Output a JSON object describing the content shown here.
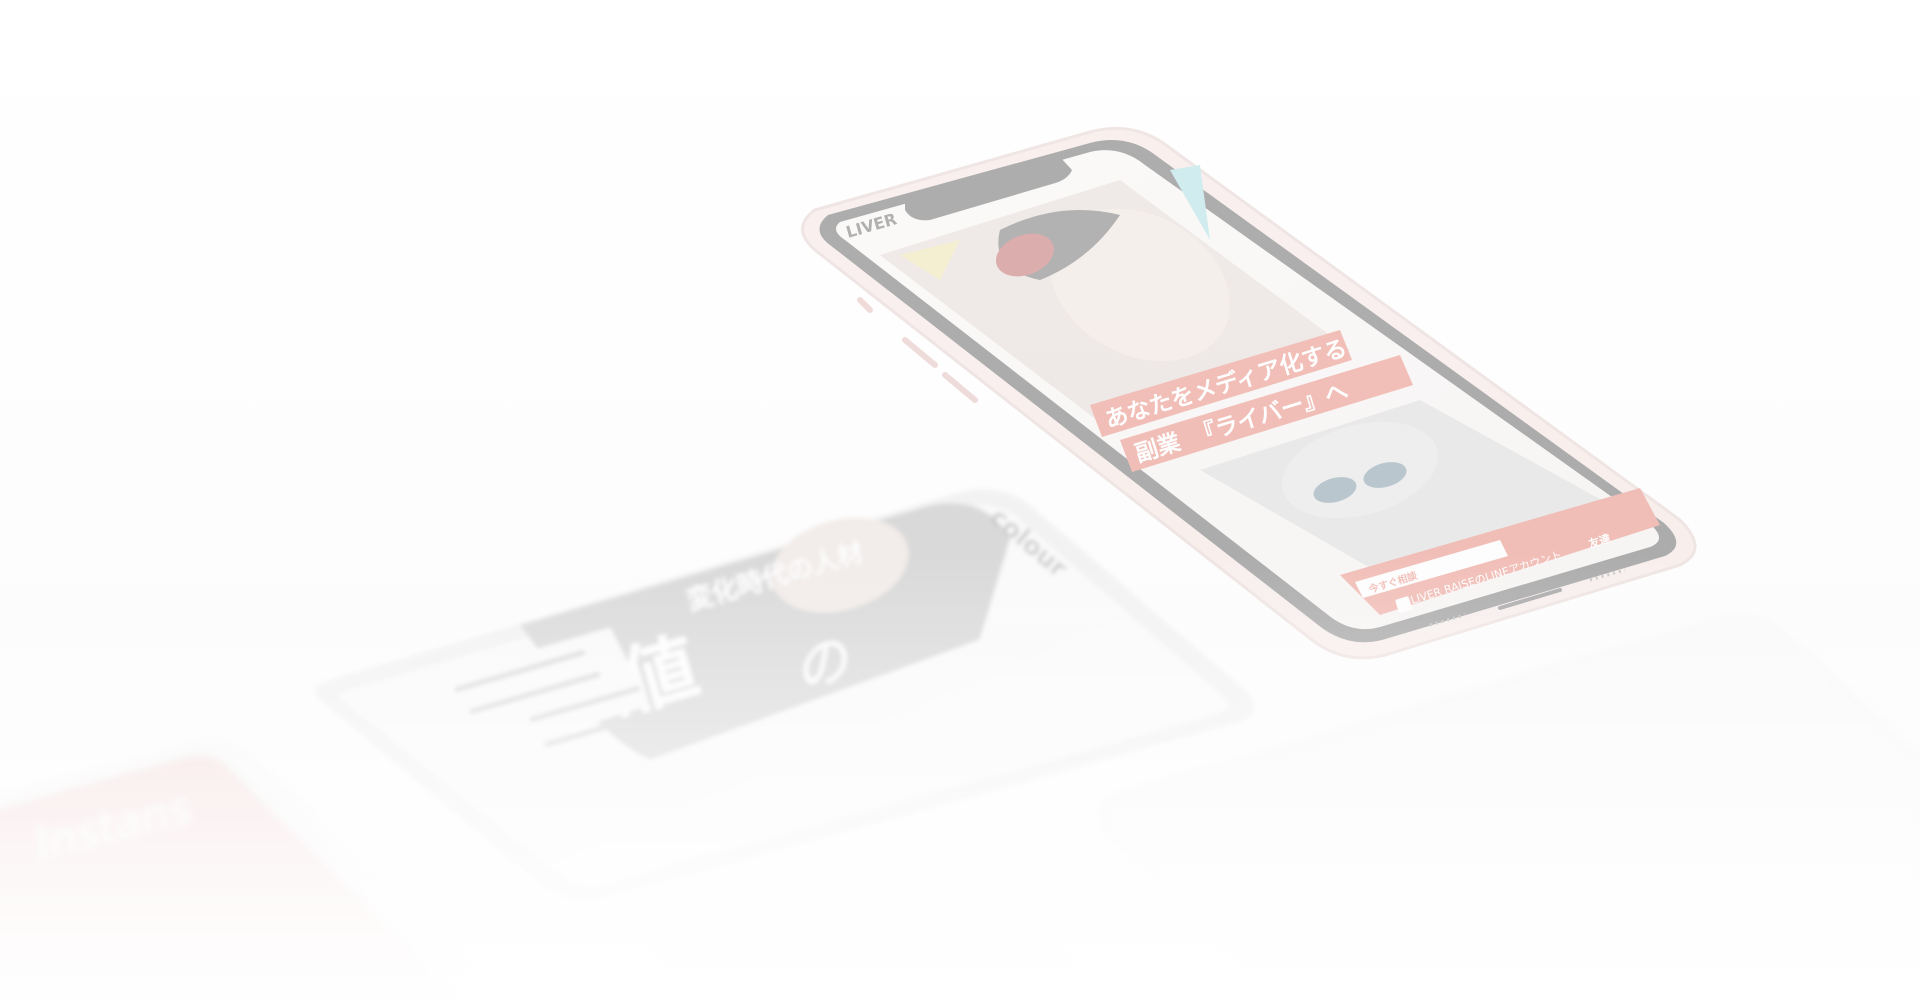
{
  "phones": {
    "front": {
      "brand": "LIVER",
      "headline_line1": "あなたをメディア化する",
      "headline_line2_lead": "副業",
      "headline_line2_quote": "『ライバー』へ",
      "cta_text": "LIVER RAISEのLINEアカウント",
      "cta_badge": "友達",
      "button_text": "今すぐ相談",
      "colors": {
        "accent": "#e05a48",
        "frame": "#f3d7d3"
      }
    },
    "middle": {
      "brand": "colour",
      "caption": "変化時代の人材",
      "headline": "価値",
      "sub": "の"
    },
    "back_left": {
      "script_text": "Instans"
    }
  }
}
